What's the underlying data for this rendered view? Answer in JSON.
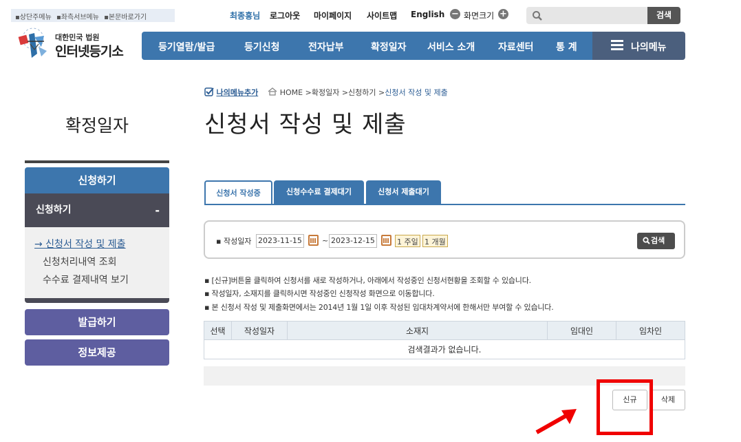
{
  "skip_links": [
    "▪상단주메뉴",
    "▪좌측서브메뉴",
    "▪본문바로가기"
  ],
  "util": {
    "user": "최종흥님",
    "logout": "로그아웃",
    "mypage": "마이페이지",
    "sitemap": "사이트맵",
    "english": "English",
    "zoom_label": "화면크기",
    "zoom_out": "−",
    "zoom_in": "+",
    "search_button": "검색",
    "search_placeholder": ""
  },
  "logo": {
    "sub": "대한민국 법원",
    "main": "인터넷등기소"
  },
  "nav": {
    "items": [
      "등기열람/발급",
      "등기신청",
      "전자납부",
      "확정일자",
      "서비스 소개",
      "자료센터",
      "통 계"
    ],
    "mymenu": "나의메뉴"
  },
  "sidebar": {
    "title": "확정일자",
    "section": "신청하기",
    "sub_header": "신청하기",
    "sub_toggle": "-",
    "items": [
      {
        "label": "→ 신청서 작성 및 제출"
      },
      {
        "label": "신청처리내역 조회"
      },
      {
        "label": "수수료 결제내역 보기"
      }
    ],
    "issue": "발급하기",
    "info": "정보제공"
  },
  "breadcrumb": {
    "add_menu": "나의메뉴추가",
    "home": "HOME",
    "sep": ">",
    "path1": "확정일자",
    "path2": "신청하기",
    "current": "신청서 작성 및 제출"
  },
  "page_title": "신청서 작성 및 제출",
  "tabs": [
    {
      "label": "신청서 작성중",
      "active": true
    },
    {
      "label": "신청수수료 결제대기",
      "active": false
    },
    {
      "label": "신청서 제출대기",
      "active": false
    }
  ],
  "search": {
    "label": "▪ 작성일자",
    "from": "2023-11-15",
    "to": "2023-12-15",
    "tilde": "~",
    "week": "1 주일",
    "month": "1 개월",
    "button": "검색"
  },
  "notes": [
    "▪ [신규]버튼을 클릭하여 신청서를 새로 작성하거나, 아래에서 작성중인 신청서현황을 조회할 수 있습니다.",
    "▪ 작성일자, 소재지를 클릭하시면 작성중인 신청작성 화면으로 이동합니다.",
    "▪ 본 신청서 작성 및 제출화면에서는 2014년 1월 1일 이후 작성된 임대차계약서에 한해서만 부여할 수 있습니다."
  ],
  "table": {
    "headers": [
      "선택",
      "작성일자",
      "소재지",
      "임대인",
      "임차인"
    ],
    "empty": "검색결과가 없습니다."
  },
  "actions": {
    "new": "신규",
    "delete": "삭제"
  },
  "colors": {
    "nav": "#3d76ad",
    "highlight": "#f00000",
    "sidebar_dark": "#4a4a56",
    "sidebar_btn": "#5e5ea0"
  }
}
